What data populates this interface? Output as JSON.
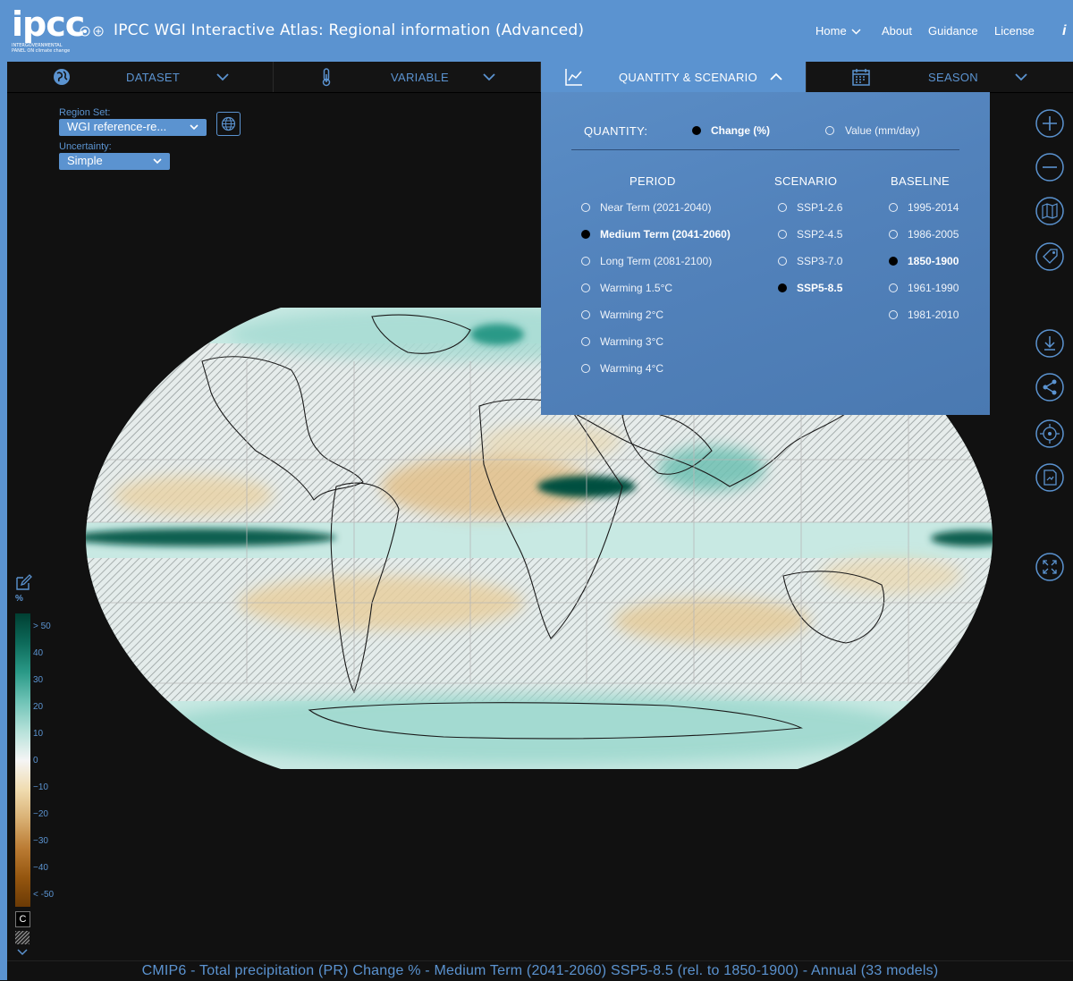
{
  "header": {
    "logo_text": "ipcc",
    "logo_subtitle": "INTERGOVERNMENTAL PANEL ON climate change",
    "title": "IPCC WGI Interactive Atlas: Regional information (Advanced)",
    "nav": {
      "home": "Home",
      "about": "About",
      "guidance": "Guidance",
      "license": "License",
      "info": "i"
    }
  },
  "tabs": {
    "dataset": "DATASET",
    "variable": "VARIABLE",
    "quantity": "QUANTITY & SCENARIO",
    "season": "SEASON"
  },
  "controls": {
    "region_set_label": "Region Set:",
    "region_set_value": "WGI reference-re...",
    "uncertainty_label": "Uncertainty:",
    "uncertainty_value": "Simple"
  },
  "panel": {
    "quantity_label": "QUANTITY:",
    "quantity_options": [
      {
        "label": "Change (%)",
        "selected": true
      },
      {
        "label": "Value (mm/day)",
        "selected": false
      }
    ],
    "period_header": "PERIOD",
    "scenario_header": "SCENARIO",
    "baseline_header": "BASELINE",
    "periods": [
      {
        "label": "Near Term (2021-2040)",
        "selected": false
      },
      {
        "label": "Medium Term (2041-2060)",
        "selected": true
      },
      {
        "label": "Long Term (2081-2100)",
        "selected": false
      },
      {
        "label": "Warming 1.5°C",
        "selected": false
      },
      {
        "label": "Warming 2°C",
        "selected": false
      },
      {
        "label": "Warming 3°C",
        "selected": false
      },
      {
        "label": "Warming 4°C",
        "selected": false
      }
    ],
    "scenarios": [
      {
        "label": "SSP1-2.6",
        "selected": false
      },
      {
        "label": "SSP2-4.5",
        "selected": false
      },
      {
        "label": "SSP3-7.0",
        "selected": false
      },
      {
        "label": "SSP5-8.5",
        "selected": true
      }
    ],
    "baselines": [
      {
        "label": "1995-2014",
        "selected": false
      },
      {
        "label": "1986-2005",
        "selected": false
      },
      {
        "label": "1850-1900",
        "selected": true
      },
      {
        "label": "1961-1990",
        "selected": false
      },
      {
        "label": "1981-2010",
        "selected": false
      }
    ]
  },
  "legend": {
    "unit": "%",
    "ticks": [
      "> 50",
      "40",
      "30",
      "20",
      "10",
      "0",
      "−10",
      "−20",
      "−30",
      "−40",
      "< -50"
    ],
    "c_label": "C"
  },
  "colors": {
    "accent": "#5b93d0",
    "background": "#111111",
    "panel": "#5282bb",
    "wet": "#0d6a5a",
    "dry": "#bb7c34"
  },
  "caption": "CMIP6 - Total precipitation (PR) Change % - Medium Term (2041-2060) SSP5-8.5 (rel. to 1850-1900) - Annual (33 models)"
}
